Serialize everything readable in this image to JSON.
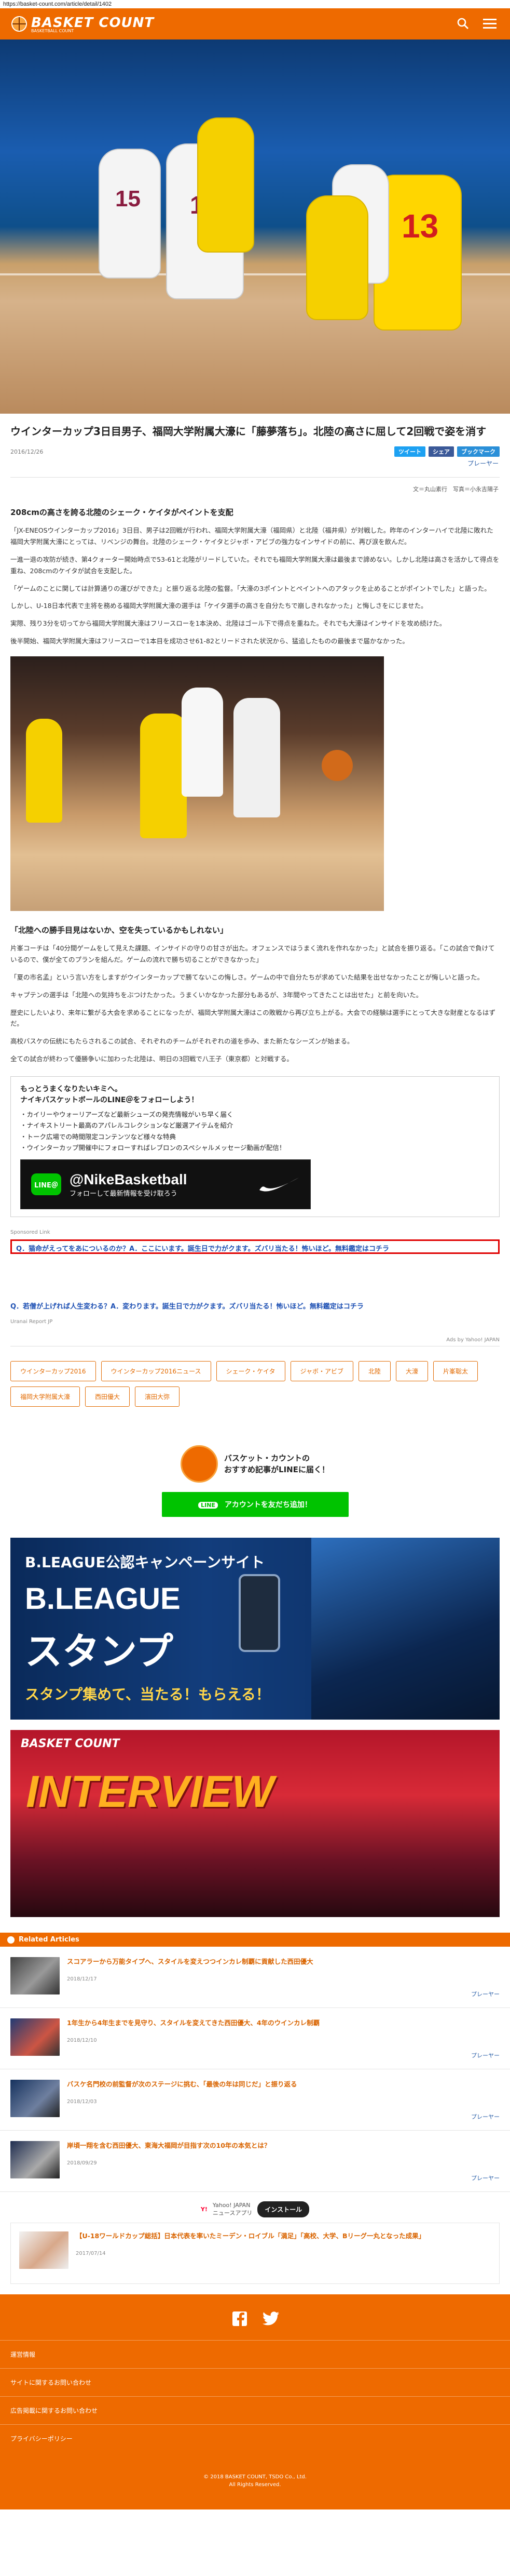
{
  "browser": {
    "url": "https://basket-count.com/article/detail/1402"
  },
  "header": {
    "logo_text": "BASKET COUNT",
    "logo_sub": "BASKETBALL COUNT"
  },
  "article": {
    "title": "ウインターカップ3日目男子、福岡大学附属大濠に「藤夢落ち」。北陸の高さに屈して2回戦で姿を消す",
    "date": "2016/12/26",
    "share_tweet": "ツイート",
    "share_fb": "シェア",
    "share_hatena": "ブックマーク",
    "player_label": "プレーヤー",
    "credit": "文＝丸山素行　写真＝小永吉陽子",
    "section1_heading": "208cmの高さを誇る北陸のシェーク・ケイタがペイントを支配",
    "p1": "「JX-ENEOSウインターカップ2016」3日目、男子は2回戦が行われ、福岡大学附属大濠（福岡県）と北陸（福井県）が対戦した。昨年のインターハイで北陸に敗れた福岡大学附属大濠にとっては、リベンジの舞台。北陸のシェーク・ケイタとジャボ・アビブの強力なインサイドの前に、再び涙を飲んだ。",
    "p2": "一進一退の攻防が続き、第4クォーター開始時点で53-61と北陸がリードしていた。それでも福岡大学附属大濠は最後まで諦めない。しかし北陸は高さを活かして得点を重ね、208cmのケイタが試合を支配した。",
    "p3": "「ゲームのことに関しては計算通りの運びができた」と振り返る北陸の監督。「大濠の3ポイントとペイントへのアタックを止めることがポイントでした」と語った。",
    "p4": "しかし、U-18日本代表で主将を務める福岡大学附属大濠の選手は「ケイタ選手の高さを自分たちで崩しきれなかった」と悔しさをにじませた。",
    "p5": "実際、残り3分を切ってから福岡大学附属大濠はフリースローを1本決め、北陸はゴール下で得点を重ねた。それでも大濠はインサイドを攻め続けた。",
    "p6": "後半開始、福岡大学附属大濠はフリースローで1本目を成功させ61-82とリードされた状況から、猛追したものの最後まで届かなかった。",
    "section2_heading": "「北陸への勝手目見はないか、空を失っているかもしれない」",
    "p7": "片峯コーチは「40分間ゲームをして見えた課題、インサイドの守りの甘さが出た。オフェンスではうまく流れを作れなかった」と試合を振り返る。「この試合で負けているので、僕が全てのプランを組んだ。ゲームの流れで勝ち切ることができなかった」",
    "p8": "「夏の市名孟」という言い方をしますがウインターカップで勝てないこの悔しさ。ゲームの中で自分たちが求めていた結果を出せなかったことが悔しいと語った。",
    "p9": "キャプテンの選手は「北陸への気持ちをぶつけたかった。うまくいかなかった部分もあるが、3年間やってきたことは出せた」と前を向いた。",
    "p10": "歴史にしたいより、来年に繋がる大会を求めることになったが、福岡大学附属大濠はこの敗戦から再び立ち上がる。大会での経験は選手にとって大きな財産となるはずだ。",
    "p11": "高校バスケの伝統にもたらされるこの試合、それぞれのチームがそれぞれの道を歩み、また新たなシーズンが始まる。",
    "p12": "全ての試合が終わって優勝争いに加わった北陸は、明日の3回戦で八王子（東京都）と対戦する。"
  },
  "promo": {
    "line1": "もっとうまくなりたいキミへ。",
    "line2": "ナイキバスケットボールのLINE＠をフォローしよう！",
    "items": [
      "・カイリーやウォーリアーズなど最新シューズの発売情報がいち早く届く",
      "・ナイキストリート最高のアパレルコレクションなど厳選アイテムを紹介",
      "・トーク広場での時間限定コンテンツなど様々な特典",
      "・ウインターカップ開催中にフォローすればレブロンのスペシャルメッセージ動画が配信！"
    ],
    "banner_line": "LINE＠",
    "banner_handle": "@NikeBasketball",
    "banner_sub": "フォローして最新情報を受け取ろう"
  },
  "ads": {
    "note": "Sponsored Link",
    "red_ad": "Q．猫命がえってをあについるのか？A．ここにいます。誕生日で力がクます。ズバリ当たる！怖いほど。無料鑑定はコチラ",
    "blue_ad": "Q．若僧が上げれば人生変わる？A．変わります。誕生日で力がクます。ズバリ当たる！怖いほど。無料鑑定はコチラ",
    "blue_sub": "Uranai Report JP",
    "yahoo": "Ads by Yahoo! JAPAN"
  },
  "tags": [
    "ウインターカップ2016",
    "ウインターカップ2016ニュース",
    "シェーク・ケイタ",
    "ジャボ・アビブ",
    "北陸",
    "大濠",
    "片峯聡太",
    "福岡大学附属大濠",
    "西田優大",
    "濱田大弥"
  ],
  "line_box": {
    "text1": "バスケット・カウントの",
    "text2": "おすすめ記事がLINEに届く！",
    "button": "アカウントを友だち追加！"
  },
  "bleague": {
    "top": "B.LEAGUE公認キャンペーンサイト",
    "main1": "B.LEAGUE",
    "main2": "スタンプ",
    "sub": "スタンプ集めて、当たる！もらえる！"
  },
  "interview": {
    "logo": "BASKET COUNT",
    "word": "INTERVIEW"
  },
  "related": {
    "heading": "Related Articles",
    "items": [
      {
        "title": "スコアラーから万能タイプへ、スタイルを変えつつインカレ制覇に貢献した西田優大",
        "date": "2018/12/17"
      },
      {
        "title": "1年生から4年生までを見守り、スタイルを変えてきた西田優大、4年のウインカレ制覇",
        "date": "2018/12/10"
      },
      {
        "title": "バスケ名門校の前監督が次のステージに挑む、「最後の年は同じだ」と振り返る",
        "date": "2018/12/03"
      },
      {
        "title": "岸頃一翔を含む西田優大、東海大福岡が目指す次の10年の本気とは？",
        "date": "2018/09/29"
      },
      {
        "title": "【U-18ワールドカップ総括】日本代表を率いたミーデン・ロイブル「満足」「高校、大学、Bリーグ一丸となった成果」",
        "date": "2017/07/14"
      }
    ],
    "player_label": "プレーヤー"
  },
  "install": {
    "brand": "Yahoo! JAPAN",
    "brand_sub": "ニュースアプリ",
    "button": "インストール"
  },
  "footer": {
    "links": [
      "運営情報",
      "サイトに関するお問い合わせ",
      "広告掲載に関するお問い合わせ",
      "プライバシーポリシー"
    ],
    "copyright1": "© 2018 BASKET COUNT, TSDO Co., Ltd.",
    "copyright2": "All Rights Reserved."
  }
}
